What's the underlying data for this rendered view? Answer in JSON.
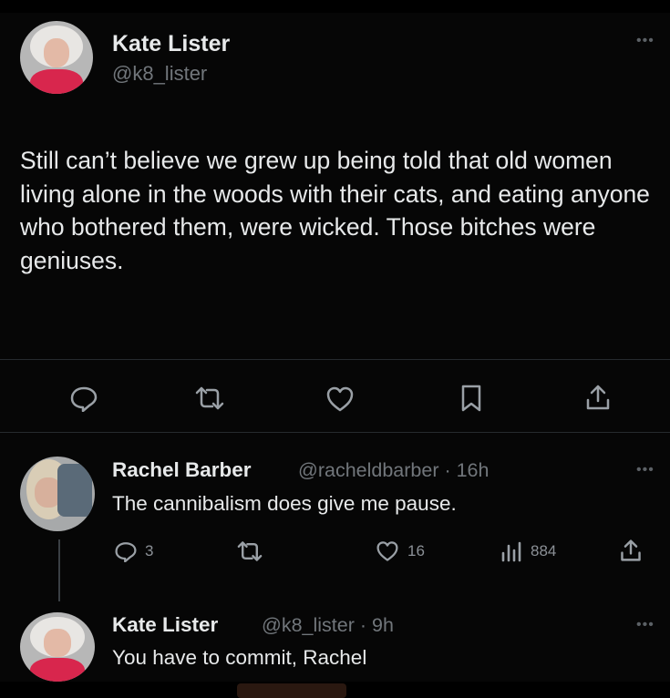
{
  "post": {
    "author_name": "Kate Lister",
    "author_handle": "@k8_lister",
    "more_label": "•••",
    "text": "Still can’t believe we grew up being told that old women living alone in the woods with their cats, and eating anyone who bothered them, were wicked. Those bitches were geniuses.",
    "actions": [
      "reply-icon",
      "repost-icon",
      "like-icon",
      "bookmark-icon",
      "share-icon"
    ]
  },
  "replies": [
    {
      "author_name": "Rachel Barber",
      "handle_time": "@racheldbarber · 16h",
      "text": "The cannibalism does give me pause.",
      "more_label": "•••",
      "reply_count": "3",
      "like_count": "16",
      "view_count": "884"
    },
    {
      "author_name": "Kate Lister",
      "handle_time": "@k8_lister · 9h",
      "text": "You have to commit, Rachel",
      "more_label": "•••"
    }
  ],
  "colors": {
    "background": "#060606",
    "text": "#e7e9ea",
    "secondary": "#71767b",
    "divider": "#262a2e",
    "avatar_shirt": "#d8264d"
  }
}
